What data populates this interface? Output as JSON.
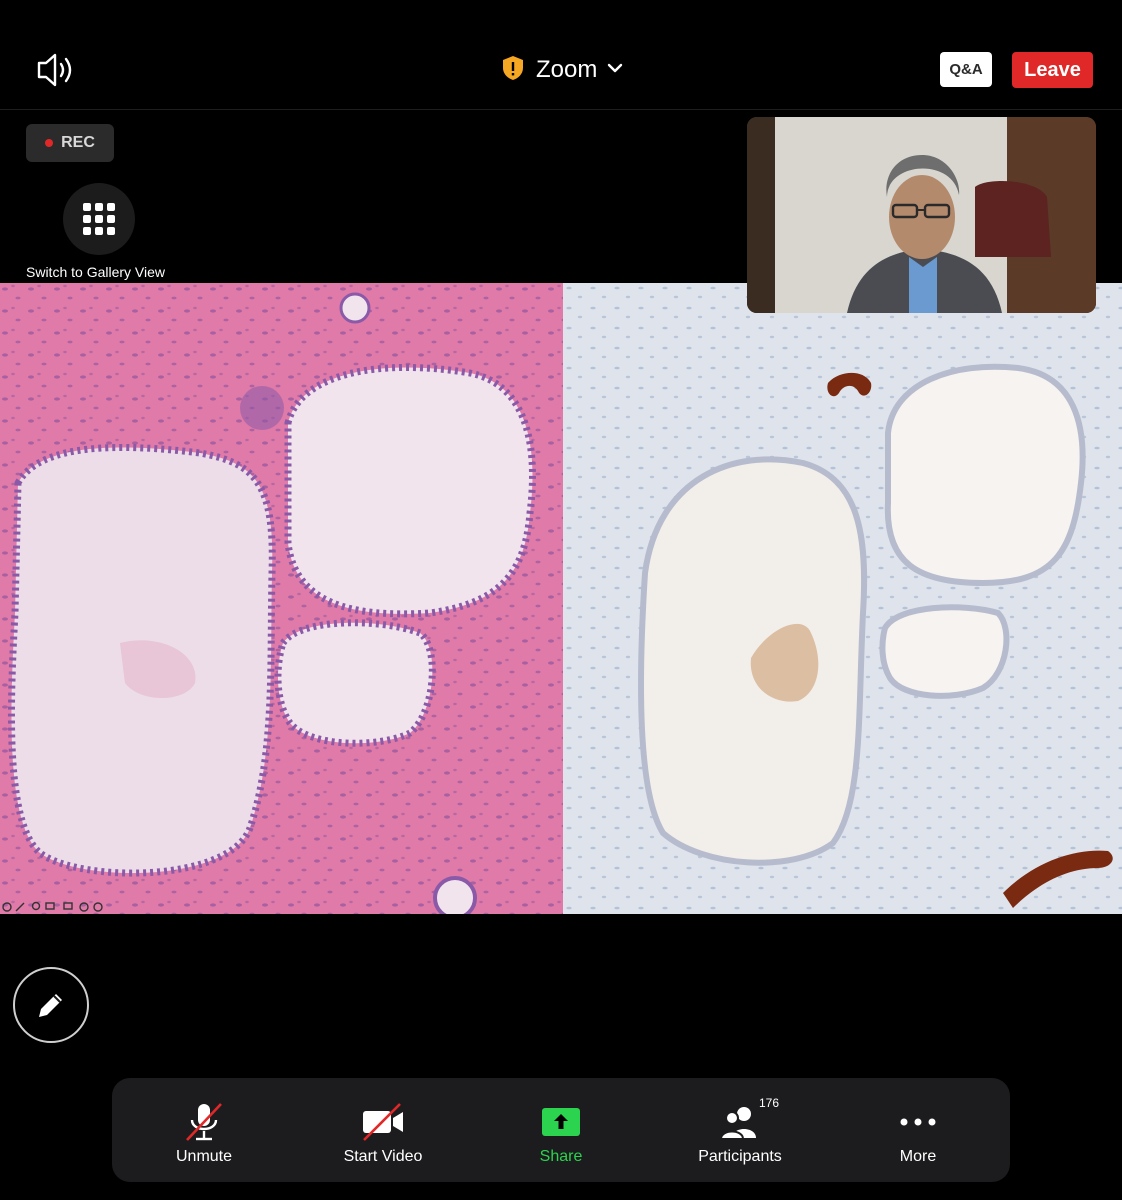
{
  "topbar": {
    "title": "Zoom",
    "qa_label": "Q&A",
    "leave_label": "Leave"
  },
  "recording": {
    "label": "REC"
  },
  "gallery": {
    "label": "Switch to Gallery View"
  },
  "toolbar": {
    "unmute_label": "Unmute",
    "start_video_label": "Start Video",
    "share_label": "Share",
    "participants_label": "Participants",
    "participants_count": "176",
    "more_label": "More"
  },
  "colors": {
    "leave": "#e02828",
    "share_green": "#2bd34e",
    "security_shield": "#f5a623",
    "rec_dot": "#e02828"
  },
  "icons": [
    "speaker-icon",
    "shield-icon",
    "chevron-down-icon",
    "grid-icon",
    "pencil-icon",
    "mic-muted-icon",
    "video-off-icon",
    "share-arrow-icon",
    "participants-icon",
    "more-dots-icon"
  ]
}
